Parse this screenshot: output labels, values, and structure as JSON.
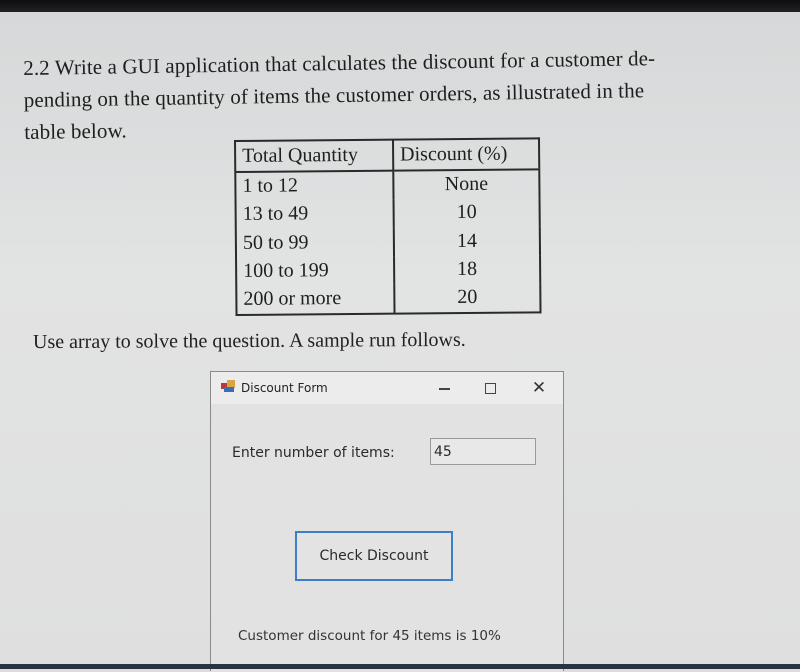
{
  "question": {
    "lines": [
      "2.2 Write a GUI application that calculates the discount for a customer de-",
      "pending on the quantity of items the customer orders, as illustrated in the",
      "table below."
    ]
  },
  "discount_table": {
    "headers": [
      "Total Quantity",
      "Discount (%)"
    ],
    "rows": [
      [
        "1 to 12",
        "None"
      ],
      [
        "13 to 49",
        "10"
      ],
      [
        "50 to 99",
        "14"
      ],
      [
        "100 to 199",
        "18"
      ],
      [
        "200 or more",
        "20"
      ]
    ]
  },
  "instruction": "Use array to solve the question. A sample run follows.",
  "window": {
    "title": "Discount Form",
    "icon": "winforms-app-icon",
    "controls": {
      "minimize": "minimize-icon",
      "maximize": "maximize-icon",
      "close_glyph": "✕"
    },
    "items_label": "Enter number of items:",
    "items_value": "45",
    "button_label": "Check Discount",
    "result_text": "Customer discount for 45 items is 10%"
  }
}
